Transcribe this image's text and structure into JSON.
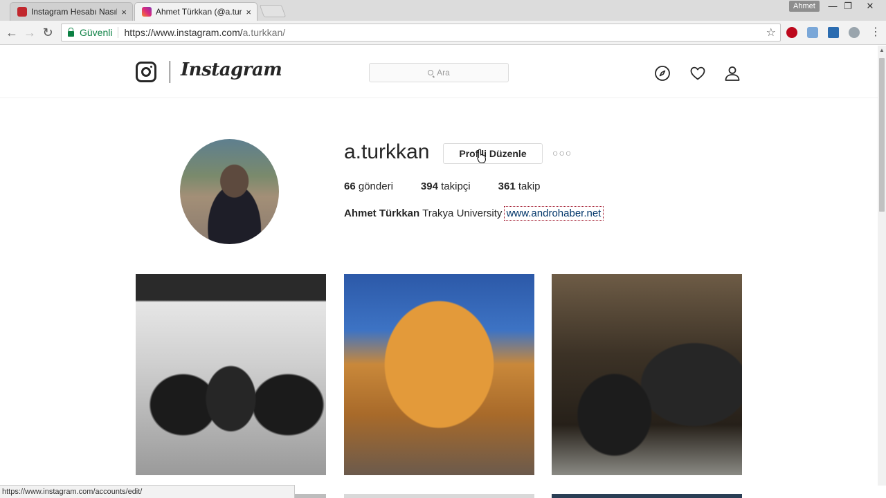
{
  "browser": {
    "tabs": [
      {
        "title": "Instagram Hesabı Nasıl Do",
        "close": "×"
      },
      {
        "title": "Ahmet Türkkan (@a.turkka",
        "close": "×"
      }
    ],
    "user_badge": "Ahmet",
    "window_controls": {
      "minimize": "—",
      "maximize": "❐",
      "close": "✕"
    },
    "nav": {
      "back": "←",
      "forward": "→",
      "reload": "↻"
    },
    "address_bar": {
      "secure_label": "Güvenli",
      "url_host": "https://www.instagram.com/",
      "url_path": "a.turkkan/"
    },
    "bookmark_star": "☆",
    "status_url": "https://www.instagram.com/accounts/edit/"
  },
  "instagram": {
    "wordmark": "Instagram",
    "search_placeholder": "Ara",
    "profile": {
      "username": "a.turkkan",
      "edit_profile_label": "Profili Düzenle",
      "more_label": "○○○",
      "stats": [
        {
          "count": "66",
          "label": "gönderi"
        },
        {
          "count": "394",
          "label": "takipçi"
        },
        {
          "count": "361",
          "label": "takip"
        }
      ],
      "full_name": "Ahmet Türkkan",
      "bio_text": "Trakya University",
      "website": "www.androhaber.net"
    },
    "colors": {
      "text": "#262626",
      "link": "#003569",
      "border": "#dbdbdb"
    }
  }
}
